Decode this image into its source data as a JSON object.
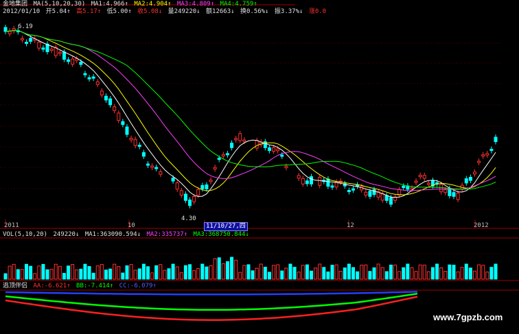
{
  "header1": {
    "name": "金地集团",
    "ma_title": "MA(5,10,20,30)",
    "ma1": "MA1:4.966↑",
    "ma2": "MA2:4.904↑",
    "ma3": "MA3:4.809↑",
    "ma4": "MA4:4.759↑"
  },
  "header2": {
    "date": "2012/01/10",
    "open": "开5.04↑",
    "high": "高5.17↑",
    "low": "低5.00↑",
    "close": "收5.08↓",
    "vol": "量249220↓",
    "amt": "额12663↓",
    "turn": "换0.56%↓",
    "amp": "振3.37%↓",
    "up": "涨0.0"
  },
  "price_labels": {
    "high": "6.19",
    "low": "4.30"
  },
  "axis": {
    "t1": "2011",
    "t2": "10",
    "cursor": "11/10/27,四",
    "t3": "12",
    "t4": "2012"
  },
  "vol_header": {
    "title": "VOL(5,10,20)",
    "value": "249220↓",
    "ma1": "MA1:363090.594↓",
    "ma2": "MA2:335737↑",
    "ma3": "MA3:368750.844↓"
  },
  "ind_header": {
    "title": "逃顶伴侣",
    "aa": "AA:-6.621↑",
    "bb": "BB:-7.414↑",
    "cc": "CC:-6.079↑"
  },
  "watermark": "www.7gpzb.com",
  "colors": {
    "up": "#ff3030",
    "down": "#00ffff",
    "ma1": "#ffffff",
    "ma2": "#ffff00",
    "ma3": "#ff40ff",
    "ma4": "#00ff00"
  }
}
